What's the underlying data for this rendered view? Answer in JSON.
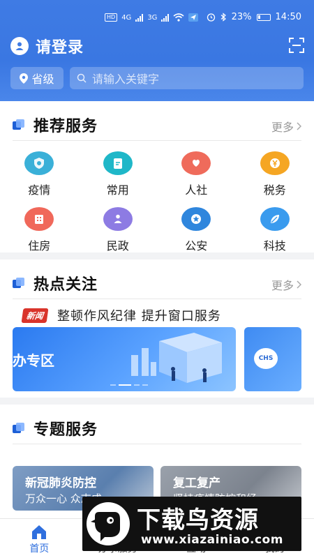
{
  "status_bar": {
    "network_badge": "HD",
    "network_4g": "4G",
    "network_3g": "3G",
    "battery": "23%",
    "time": "14:50"
  },
  "header": {
    "login_label": "请登录",
    "province_label": "省级",
    "search_placeholder": "请输入关键字"
  },
  "recommended": {
    "title": "推荐服务",
    "more_label": "更多",
    "items": [
      {
        "label": "疫情",
        "icon": "shield-virus-icon",
        "color": "#3ab0d8"
      },
      {
        "label": "常用",
        "icon": "clipboard-edit-icon",
        "color": "#1fb7c8"
      },
      {
        "label": "人社",
        "icon": "hands-heart-icon",
        "color": "#ef6b5b"
      },
      {
        "label": "税务",
        "icon": "tax-yen-icon",
        "color": "#f5a623"
      },
      {
        "label": "住房",
        "icon": "building-icon",
        "color": "#f0685a"
      },
      {
        "label": "民政",
        "icon": "people-icon",
        "color": "#8d7be3"
      },
      {
        "label": "公安",
        "icon": "police-badge-icon",
        "color": "#2f86dd"
      },
      {
        "label": "科技",
        "icon": "leaf-tech-icon",
        "color": "#3a9bee"
      }
    ]
  },
  "hot": {
    "title": "热点关注",
    "more_label": "更多",
    "news_tag": "新闻",
    "headline": "整顿作风纪律 提升窗口服务",
    "banner_text": "办专区",
    "side_banner_text": "CHS"
  },
  "topics": {
    "title": "专题服务",
    "cards": [
      {
        "title": "新冠肺炎防控",
        "subtitle": "万众一心 众志成...",
        "color": "#6e8fb8"
      },
      {
        "title": "复工复产",
        "subtitle": "坚持疫情防控和经...",
        "color": "#8a8f9a"
      }
    ]
  },
  "tabbar": {
    "tabs": [
      {
        "label": "首页",
        "active": true
      },
      {
        "label": "办事服务",
        "active": false
      },
      {
        "label": "互动",
        "active": false
      },
      {
        "label": "我的",
        "active": false
      }
    ]
  },
  "watermark": {
    "title": "下载鸟资源",
    "url": "www.xiazainiao.com"
  },
  "colors": {
    "header_blue": "#3f7be4",
    "active_tab": "#2f6fde",
    "news_red": "#d9342b"
  }
}
